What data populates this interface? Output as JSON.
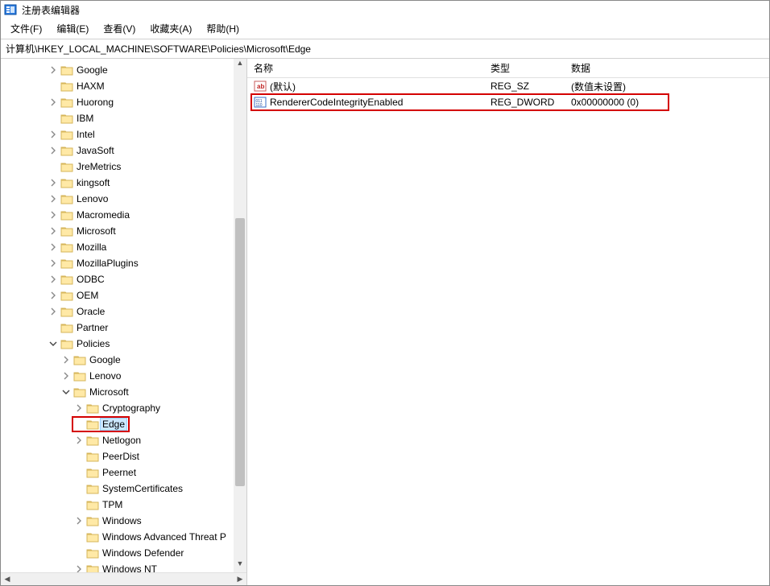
{
  "window": {
    "title": "注册表编辑器"
  },
  "menu": {
    "file": "文件(F)",
    "edit": "编辑(E)",
    "view": "查看(V)",
    "favorites": "收藏夹(A)",
    "help": "帮助(H)"
  },
  "address": "计算机\\HKEY_LOCAL_MACHINE\\SOFTWARE\\Policies\\Microsoft\\Edge",
  "tree": [
    {
      "depth": 3,
      "expand": "closed",
      "label": "Google"
    },
    {
      "depth": 3,
      "expand": "none",
      "label": "HAXM"
    },
    {
      "depth": 3,
      "expand": "closed",
      "label": "Huorong"
    },
    {
      "depth": 3,
      "expand": "none",
      "label": "IBM"
    },
    {
      "depth": 3,
      "expand": "closed",
      "label": "Intel"
    },
    {
      "depth": 3,
      "expand": "closed",
      "label": "JavaSoft"
    },
    {
      "depth": 3,
      "expand": "none",
      "label": "JreMetrics"
    },
    {
      "depth": 3,
      "expand": "closed",
      "label": "kingsoft"
    },
    {
      "depth": 3,
      "expand": "closed",
      "label": "Lenovo"
    },
    {
      "depth": 3,
      "expand": "closed",
      "label": "Macromedia"
    },
    {
      "depth": 3,
      "expand": "closed",
      "label": "Microsoft"
    },
    {
      "depth": 3,
      "expand": "closed",
      "label": "Mozilla"
    },
    {
      "depth": 3,
      "expand": "closed",
      "label": "MozillaPlugins"
    },
    {
      "depth": 3,
      "expand": "closed",
      "label": "ODBC"
    },
    {
      "depth": 3,
      "expand": "closed",
      "label": "OEM"
    },
    {
      "depth": 3,
      "expand": "closed",
      "label": "Oracle"
    },
    {
      "depth": 3,
      "expand": "none",
      "label": "Partner"
    },
    {
      "depth": 3,
      "expand": "open",
      "label": "Policies"
    },
    {
      "depth": 4,
      "expand": "closed",
      "label": "Google"
    },
    {
      "depth": 4,
      "expand": "closed",
      "label": "Lenovo"
    },
    {
      "depth": 4,
      "expand": "open",
      "label": "Microsoft"
    },
    {
      "depth": 5,
      "expand": "closed",
      "label": "Cryptography"
    },
    {
      "depth": 5,
      "expand": "none",
      "label": "Edge",
      "selected": true,
      "highlight": true
    },
    {
      "depth": 5,
      "expand": "closed",
      "label": "Netlogon"
    },
    {
      "depth": 5,
      "expand": "none",
      "label": "PeerDist"
    },
    {
      "depth": 5,
      "expand": "none",
      "label": "Peernet"
    },
    {
      "depth": 5,
      "expand": "none",
      "label": "SystemCertificates"
    },
    {
      "depth": 5,
      "expand": "none",
      "label": "TPM"
    },
    {
      "depth": 5,
      "expand": "closed",
      "label": "Windows"
    },
    {
      "depth": 5,
      "expand": "none",
      "label": "Windows Advanced Threat P"
    },
    {
      "depth": 5,
      "expand": "none",
      "label": "Windows Defender"
    },
    {
      "depth": 5,
      "expand": "closed",
      "label": "Windows NT"
    }
  ],
  "list": {
    "headers": {
      "name": "名称",
      "type": "类型",
      "data": "数据"
    },
    "rows": [
      {
        "icon": "string",
        "name": "(默认)",
        "type": "REG_SZ",
        "data": "(数值未设置)"
      },
      {
        "icon": "dword",
        "name": "RendererCodeIntegrityEnabled",
        "type": "REG_DWORD",
        "data": "0x00000000 (0)",
        "highlight": true
      }
    ]
  }
}
